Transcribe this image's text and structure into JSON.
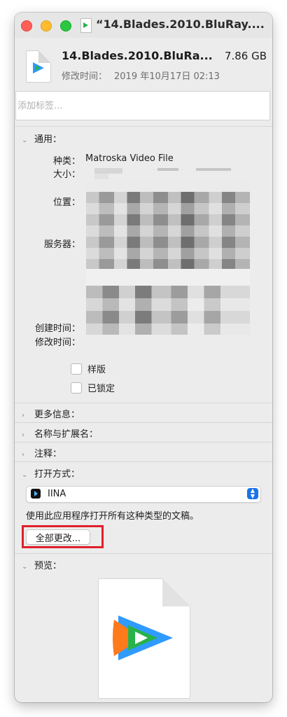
{
  "window": {
    "title": "“14.Blades.2010.BluRay....",
    "traffic_lights": [
      "close",
      "minimize",
      "zoom"
    ]
  },
  "header": {
    "filename": "14.Blades.2010.BluRa...",
    "size": "7.86 GB",
    "modified_label": "修改时间：",
    "modified_value": "2019 年10月17日 02:13"
  },
  "tags": {
    "placeholder": "添加标签..."
  },
  "sections": {
    "general": "通用：",
    "more_info": "更多信息：",
    "name_ext": "名称与扩展名：",
    "comments": "注释：",
    "open_with": "打开方式：",
    "preview": "预览："
  },
  "general": {
    "kind_label": "种类：",
    "kind_value": "Matroska Video File",
    "size_label": "大小：",
    "where_label": "位置：",
    "server_label": "服务器：",
    "created_label": "创建时间：",
    "modified_label": "修改时间：",
    "stationery_label": "样版",
    "locked_label": "已锁定"
  },
  "open_with": {
    "app": "IINA",
    "hint": "使用此应用程序打开所有这种类型的文稿。",
    "change_all": "全部更改..."
  },
  "colors": {
    "accent": "#1a73e8",
    "highlight": "#e0202a",
    "logo_blue": "#2f9bff",
    "logo_orange": "#ff7a1a",
    "logo_green": "#27b24a"
  }
}
